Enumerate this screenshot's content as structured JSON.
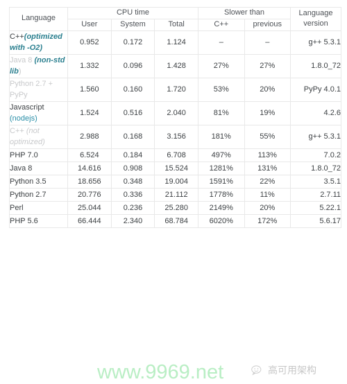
{
  "table": {
    "header": {
      "language": "Language",
      "cpu_time_group": "CPU time",
      "slower_than_group": "Slower than",
      "language_version": "Language version",
      "user": "User",
      "system": "System",
      "total": "Total",
      "cpp": "C++",
      "previous": "previous"
    },
    "rows": [
      {
        "name_parts": [
          {
            "text": "C++",
            "style": "dark"
          },
          {
            "text": "(optimized with -O2)",
            "style": "teal"
          }
        ],
        "user": "0.952",
        "system": "0.172",
        "total": "1.124",
        "slower_cpp": "–",
        "slower_prev": "–",
        "version": "g++ 5.3.1"
      },
      {
        "name_parts": [
          {
            "text": "Java 8 ",
            "style": "mute"
          },
          {
            "text": "(non-std lib",
            "style": "teal"
          },
          {
            "text": ")",
            "style": "mute"
          }
        ],
        "user": "1.332",
        "system": "0.096",
        "total": "1.428",
        "slower_cpp": "27%",
        "slower_prev": "27%",
        "version": "1.8.0_72"
      },
      {
        "name_parts": [
          {
            "text": "Python 2.7 + PyPy",
            "style": "mute"
          }
        ],
        "user": "1.560",
        "system": "0.160",
        "total": "1.720",
        "slower_cpp": "53%",
        "slower_prev": "20%",
        "version": "PyPy 4.0.1"
      },
      {
        "name_parts": [
          {
            "text": "Javascript ",
            "style": "dark"
          },
          {
            "text": "(nodejs)",
            "style": "link"
          }
        ],
        "user": "1.524",
        "system": "0.516",
        "total": "2.040",
        "slower_cpp": "81%",
        "slower_prev": "19%",
        "version": "4.2.6"
      },
      {
        "name_parts": [
          {
            "text": "C++ ",
            "style": "mute"
          },
          {
            "text": "(not optimized)",
            "style": "muteit"
          }
        ],
        "user": "2.988",
        "system": "0.168",
        "total": "3.156",
        "slower_cpp": "181%",
        "slower_prev": "55%",
        "version": "g++ 5.3.1"
      },
      {
        "name_parts": [
          {
            "text": "PHP 7.0",
            "style": "dark"
          }
        ],
        "user": "6.524",
        "system": "0.184",
        "total": "6.708",
        "slower_cpp": "497%",
        "slower_prev": "113%",
        "version": "7.0.2"
      },
      {
        "name_parts": [
          {
            "text": "Java 8",
            "style": "dark"
          }
        ],
        "user": "14.616",
        "system": "0.908",
        "total": "15.524",
        "slower_cpp": "1281%",
        "slower_prev": "131%",
        "version": "1.8.0_72"
      },
      {
        "name_parts": [
          {
            "text": "Python 3.5",
            "style": "dark"
          }
        ],
        "user": "18.656",
        "system": "0.348",
        "total": "19.004",
        "slower_cpp": "1591%",
        "slower_prev": "22%",
        "version": "3.5.1"
      },
      {
        "name_parts": [
          {
            "text": "Python 2.7",
            "style": "dark"
          }
        ],
        "user": "20.776",
        "system": "0.336",
        "total": "21.112",
        "slower_cpp": "1778%",
        "slower_prev": "11%",
        "version": "2.7.11"
      },
      {
        "name_parts": [
          {
            "text": "Perl",
            "style": "dark"
          }
        ],
        "user": "25.044",
        "system": "0.236",
        "total": "25.280",
        "slower_cpp": "2149%",
        "slower_prev": "20%",
        "version": "5.22.1"
      },
      {
        "name_parts": [
          {
            "text": "PHP 5.6",
            "style": "dark"
          }
        ],
        "user": "66.444",
        "system": "2.340",
        "total": "68.784",
        "slower_cpp": "6020%",
        "slower_prev": "172%",
        "version": "5.6.17"
      }
    ]
  },
  "watermark": {
    "url": "www.9969.net",
    "url_color": "#b9eec4",
    "brand_text": "高可用架构",
    "brand_icon": "wechat-icon"
  }
}
